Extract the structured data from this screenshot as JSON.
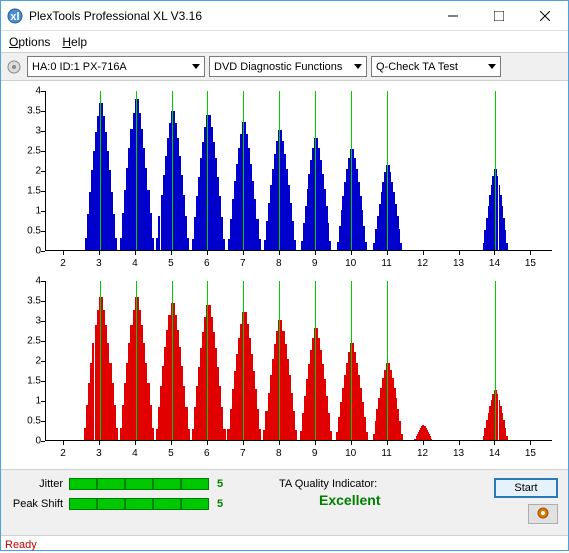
{
  "window": {
    "title": "PlexTools Professional XL V3.16"
  },
  "menu": {
    "options": "Options",
    "help": "Help"
  },
  "toolbar": {
    "drive": "HA:0 ID:1   PX-716A",
    "functions": "DVD Diagnostic Functions",
    "test": "Q-Check TA Test"
  },
  "chart_data": [
    {
      "type": "bar",
      "color": "blue",
      "ylim": [
        0,
        4
      ],
      "yticks": [
        0,
        0.5,
        1,
        1.5,
        2,
        2.5,
        3,
        3.5,
        4
      ],
      "xticks": [
        2,
        3,
        4,
        5,
        6,
        7,
        8,
        9,
        10,
        11,
        12,
        13,
        14,
        15
      ],
      "xrange": [
        1.5,
        15.6
      ],
      "vlines": [
        3,
        4,
        5,
        6,
        7,
        8,
        9,
        10,
        11,
        14
      ],
      "series": [
        {
          "cx": 3.0,
          "peak": 3.8,
          "w": 0.9
        },
        {
          "cx": 4.0,
          "peak": 3.9,
          "w": 0.95
        },
        {
          "cx": 5.0,
          "peak": 3.6,
          "w": 0.9
        },
        {
          "cx": 6.0,
          "peak": 3.5,
          "w": 0.9
        },
        {
          "cx": 7.0,
          "peak": 3.3,
          "w": 0.9
        },
        {
          "cx": 8.0,
          "peak": 3.1,
          "w": 0.9
        },
        {
          "cx": 9.0,
          "peak": 2.9,
          "w": 0.85
        },
        {
          "cx": 10.0,
          "peak": 2.6,
          "w": 0.85
        },
        {
          "cx": 11.0,
          "peak": 2.2,
          "w": 0.8
        },
        {
          "cx": 14.0,
          "peak": 2.1,
          "w": 0.7
        }
      ]
    },
    {
      "type": "bar",
      "color": "red",
      "ylim": [
        0,
        4
      ],
      "yticks": [
        0,
        0.5,
        1,
        1.5,
        2,
        2.5,
        3,
        3.5,
        4
      ],
      "xticks": [
        2,
        3,
        4,
        5,
        6,
        7,
        8,
        9,
        10,
        11,
        12,
        13,
        14,
        15
      ],
      "xrange": [
        1.5,
        15.6
      ],
      "vlines": [
        3,
        4,
        5,
        6,
        7,
        8,
        9,
        10,
        11,
        14
      ],
      "series": [
        {
          "cx": 3.0,
          "peak": 3.7,
          "w": 0.95
        },
        {
          "cx": 4.0,
          "peak": 3.7,
          "w": 0.95
        },
        {
          "cx": 5.0,
          "peak": 3.55,
          "w": 0.95
        },
        {
          "cx": 6.0,
          "peak": 3.5,
          "w": 0.95
        },
        {
          "cx": 7.0,
          "peak": 3.3,
          "w": 0.95
        },
        {
          "cx": 8.0,
          "peak": 3.1,
          "w": 0.95
        },
        {
          "cx": 9.0,
          "peak": 2.9,
          "w": 0.9
        },
        {
          "cx": 10.0,
          "peak": 2.5,
          "w": 0.9
        },
        {
          "cx": 11.0,
          "peak": 2.0,
          "w": 0.85
        },
        {
          "cx": 12.0,
          "peak": 0.4,
          "w": 0.5
        },
        {
          "cx": 14.0,
          "peak": 1.3,
          "w": 0.7
        }
      ]
    }
  ],
  "metrics": {
    "jitter_label": "Jitter",
    "jitter_value": "5",
    "jitter_fill": 5,
    "peakshift_label": "Peak Shift",
    "peakshift_value": "5",
    "peakshift_fill": 5
  },
  "ta": {
    "label": "TA Quality Indicator:",
    "value": "Excellent"
  },
  "buttons": {
    "start": "Start"
  },
  "status": {
    "text": "Ready"
  }
}
